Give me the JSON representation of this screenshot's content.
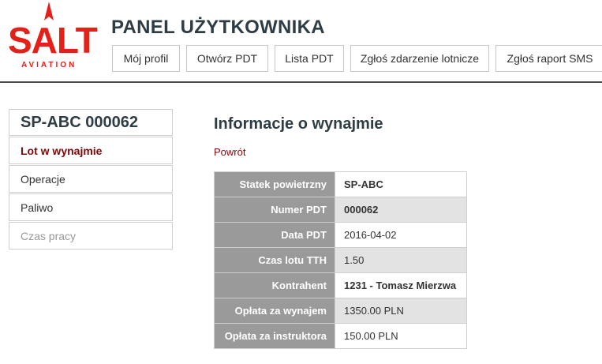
{
  "brand": {
    "logo_name": "SALT",
    "logo_sub": "AVIATION",
    "color": "#e32119"
  },
  "header": {
    "title": "PANEL UŻYTKOWNIKA",
    "nav": [
      {
        "label": "Mój profil"
      },
      {
        "label": "Otwórz PDT"
      },
      {
        "label": "Lista PDT"
      },
      {
        "label": "Zgłoś zdarzenie lotnicze"
      },
      {
        "label": "Zgłoś raport SMS"
      }
    ]
  },
  "sidebar": {
    "title": "SP-ABC 000062",
    "items": [
      {
        "label": "Lot w wynajmie",
        "state": "active"
      },
      {
        "label": "Operacje",
        "state": "normal"
      },
      {
        "label": "Paliwo",
        "state": "normal"
      },
      {
        "label": "Czas pracy",
        "state": "disabled"
      }
    ]
  },
  "main": {
    "title": "Informacje o wynajmie",
    "back_label": "Powrót",
    "rows": [
      {
        "label": "Statek powietrzny",
        "value": "SP-ABC"
      },
      {
        "label": "Numer PDT",
        "value": "000062"
      },
      {
        "label": "Data PDT",
        "value": "2016-04-02"
      },
      {
        "label": "Czas lotu TTH",
        "value": "1.50"
      },
      {
        "label": "Kontrahent",
        "value": "1231 - Tomasz Mierzwa"
      },
      {
        "label": "Opłata za wynajem",
        "value": "1350.00 PLN"
      },
      {
        "label": "Opłata za instruktora",
        "value": "150.00 PLN"
      }
    ]
  },
  "colors": {
    "accent_dark_red": "#7a0a0a",
    "heading": "#2e3c44",
    "label_bg": "#9a9a9a"
  }
}
